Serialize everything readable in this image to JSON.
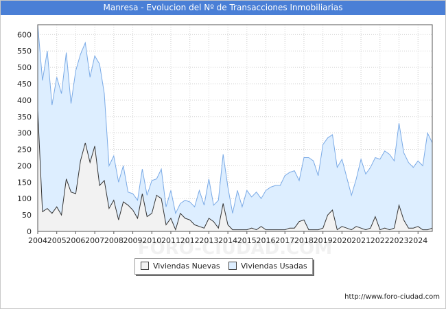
{
  "title": "Manresa - Evolucion del Nº de Transacciones Inmobiliarias",
  "footer_url": "http://www.foro-ciudad.com",
  "watermark": "FORO-CIUDAD.COM",
  "colors": {
    "title_bg": "#4a7fd6",
    "nuevas_fill": "#f2f2f2",
    "nuevas_line": "#333333",
    "usadas_fill": "#ddeeff",
    "usadas_line": "#7aaae6",
    "grid": "#d0d0d0"
  },
  "chart_data": {
    "type": "area",
    "title": "Manresa - Evolucion del Nº de Transacciones Inmobiliarias",
    "xlabel": "",
    "ylabel": "",
    "ylim": [
      0,
      630
    ],
    "x_range": [
      2004,
      2024.75
    ],
    "grid": true,
    "legend_position": "bottom",
    "x_tick_labels": [
      "2004",
      "2005",
      "2006",
      "2007",
      "2008",
      "2009",
      "2010",
      "2011",
      "2012",
      "2013",
      "2014",
      "2015",
      "2016",
      "2017",
      "2018",
      "2019",
      "2020",
      "2021",
      "2022",
      "2023",
      "2024"
    ],
    "y_tick_labels": [
      "0",
      "50",
      "100",
      "150",
      "200",
      "250",
      "300",
      "350",
      "400",
      "450",
      "500",
      "550",
      "600"
    ],
    "x": [
      2004,
      2004.25,
      2004.5,
      2004.75,
      2005,
      2005.25,
      2005.5,
      2005.75,
      2006,
      2006.25,
      2006.5,
      2006.75,
      2007,
      2007.25,
      2007.5,
      2007.75,
      2008,
      2008.25,
      2008.5,
      2008.75,
      2009,
      2009.25,
      2009.5,
      2009.75,
      2010,
      2010.25,
      2010.5,
      2010.75,
      2011,
      2011.25,
      2011.5,
      2011.75,
      2012,
      2012.25,
      2012.5,
      2012.75,
      2013,
      2013.25,
      2013.5,
      2013.75,
      2014,
      2014.25,
      2014.5,
      2014.75,
      2015,
      2015.25,
      2015.5,
      2015.75,
      2016,
      2016.25,
      2016.5,
      2016.75,
      2017,
      2017.25,
      2017.5,
      2017.75,
      2018,
      2018.25,
      2018.5,
      2018.75,
      2019,
      2019.25,
      2019.5,
      2019.75,
      2020,
      2020.25,
      2020.5,
      2020.75,
      2021,
      2021.25,
      2021.5,
      2021.75,
      2022,
      2022.25,
      2022.5,
      2022.75,
      2023,
      2023.25,
      2023.5,
      2023.75,
      2024,
      2024.25,
      2024.5,
      2024.75
    ],
    "series": [
      {
        "name": "Viviendas Nuevas",
        "values": [
          370,
          60,
          70,
          55,
          75,
          50,
          160,
          120,
          115,
          215,
          270,
          210,
          260,
          140,
          155,
          70,
          95,
          35,
          90,
          80,
          65,
          40,
          115,
          45,
          55,
          110,
          100,
          20,
          40,
          5,
          55,
          40,
          35,
          20,
          15,
          10,
          40,
          30,
          10,
          85,
          20,
          5,
          5,
          5,
          5,
          10,
          5,
          15,
          5,
          5,
          5,
          5,
          5,
          10,
          10,
          30,
          35,
          5,
          5,
          5,
          10,
          50,
          65,
          5,
          15,
          10,
          5,
          15,
          10,
          5,
          10,
          45,
          5,
          10,
          5,
          10,
          80,
          35,
          10,
          10,
          15,
          5,
          5,
          10
        ]
      },
      {
        "name": "Viviendas Usadas",
        "values": [
          650,
          460,
          550,
          385,
          470,
          420,
          545,
          390,
          490,
          540,
          575,
          470,
          535,
          510,
          420,
          200,
          230,
          150,
          200,
          120,
          115,
          95,
          190,
          110,
          155,
          160,
          190,
          75,
          125,
          55,
          85,
          95,
          90,
          75,
          125,
          80,
          160,
          80,
          95,
          235,
          135,
          55,
          125,
          75,
          125,
          105,
          120,
          100,
          125,
          135,
          140,
          140,
          170,
          180,
          185,
          155,
          225,
          225,
          215,
          170,
          265,
          285,
          295,
          195,
          220,
          165,
          110,
          160,
          220,
          175,
          195,
          225,
          220,
          245,
          235,
          215,
          330,
          240,
          210,
          195,
          215,
          200,
          300,
          270
        ]
      }
    ]
  },
  "legend": {
    "items": [
      {
        "label": "Viviendas Nuevas"
      },
      {
        "label": "Viviendas Usadas"
      }
    ]
  }
}
